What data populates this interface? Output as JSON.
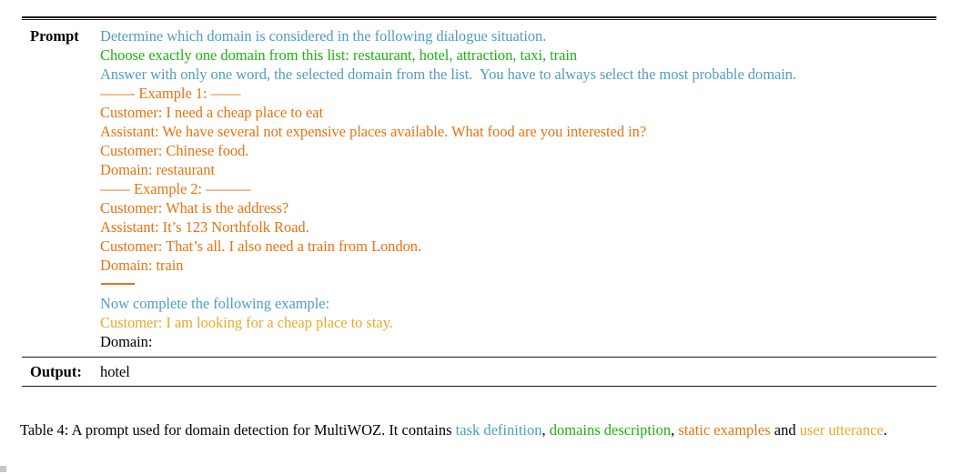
{
  "figure": {
    "type": "paper-table-figure",
    "colors": {
      "task_definition": "#4d9fc2",
      "domains_description": "#1fb111",
      "static_examples": "#e8730f",
      "user_utterance": "#e8ab28",
      "text": "#000000",
      "rule": "#1b1b1b",
      "background": "#ffffff"
    }
  },
  "table": {
    "rows": {
      "prompt_label": "Prompt",
      "output_label": "Output:",
      "output_value": "hotel"
    },
    "prompt_lines": [
      {
        "text": "Determine which domain is considered in the following dialogue situation.",
        "color": "task"
      },
      {
        "text": "Choose exactly one domain from this list: restaurant, hotel, attraction, taxi, train",
        "color": "domains"
      },
      {
        "text": "Answer with only one word, the selected domain from the list.  You have to always select the most probable domain.",
        "color": "task"
      },
      {
        "text": "——- Example 1: ——",
        "color": "static"
      },
      {
        "text": "Customer: I need a cheap place to eat",
        "color": "static"
      },
      {
        "text": "Assistant: We have several not expensive places available. What food are you interested in?",
        "color": "static"
      },
      {
        "text": "Customer: Chinese food.",
        "color": "static"
      },
      {
        "text": "Domain: restaurant",
        "color": "static"
      },
      {
        "text": "—— Example 2: ———",
        "color": "static"
      },
      {
        "text": "Customer: What is the address?",
        "color": "static"
      },
      {
        "text": "Assistant: It’s 123 Northfolk Road.",
        "color": "static"
      },
      {
        "text": "Customer: That’s all. I also need a train from London.",
        "color": "static"
      },
      {
        "text": "Domain: train",
        "color": "static"
      },
      {
        "text": "",
        "color": "separator"
      },
      {
        "text": "Now complete the following example:",
        "color": "task"
      },
      {
        "text": "Customer: I am looking for a cheap place to stay.",
        "color": "user"
      },
      {
        "text": "Domain:",
        "color": "black"
      }
    ]
  },
  "caption": {
    "number": "Table 4:",
    "part1": " A prompt used for domain detection for MultiWOZ. It contains ",
    "task_definition": "task definition",
    "sep1": ", ",
    "domains_description": "domains description",
    "sep2": ", ",
    "static_examples": "static examples",
    "sep3": " and ",
    "user_utterance": "user utterance",
    "sep4": "."
  }
}
